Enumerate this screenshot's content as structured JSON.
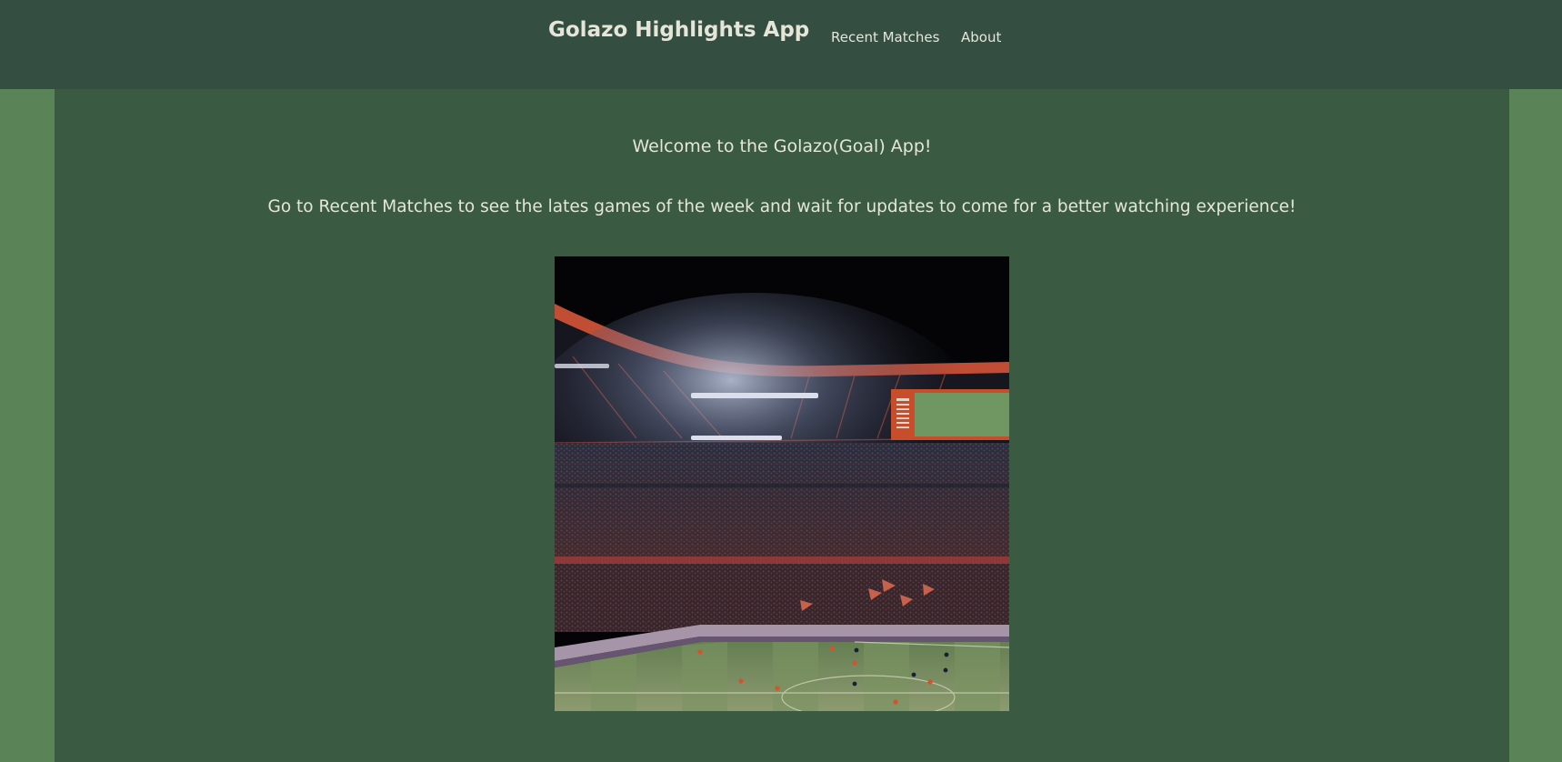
{
  "header": {
    "brand": "Golazo Highlights App",
    "nav": [
      {
        "label": "Recent Matches"
      },
      {
        "label": "About"
      }
    ]
  },
  "main": {
    "welcome": "Welcome to the Golazo(Goal) App!",
    "intro": "Go to Recent Matches to see the lates games of the week and wait for updates to come for a better watching experience!",
    "image": {
      "subject": "stadium-photo"
    }
  },
  "colors": {
    "header_bg": "#344f42",
    "main_bg": "#3b5a42",
    "page_bg": "#5a8358",
    "text": "#e6e6d8"
  }
}
